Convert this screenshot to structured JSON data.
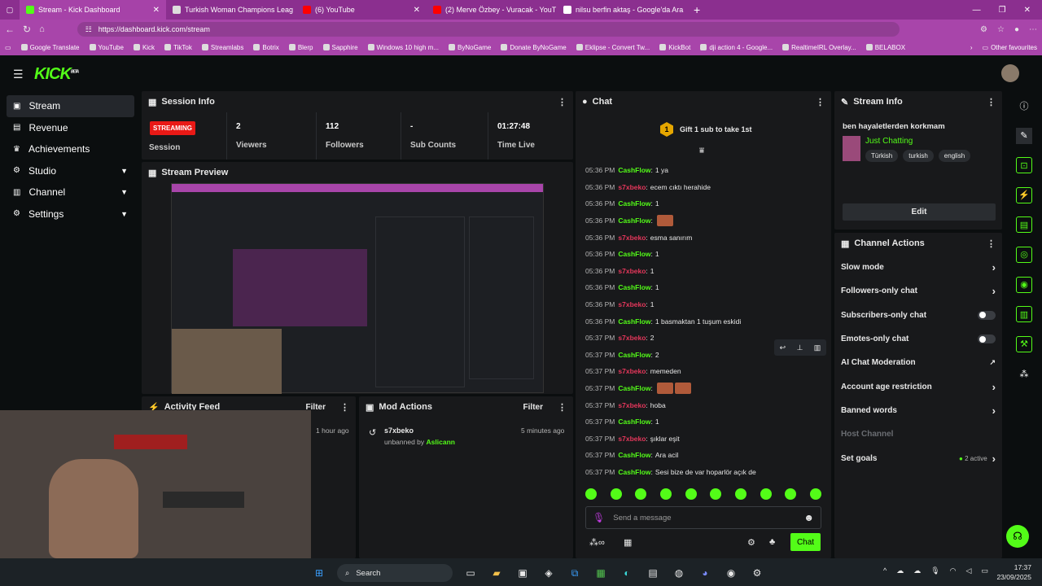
{
  "browser": {
    "tabs": [
      {
        "label": "Stream - Kick Dashboard",
        "color": "#53fc18"
      },
      {
        "label": "Turkish Woman Champions Leag",
        "color": "#dddddd"
      },
      {
        "label": "(6) YouTube",
        "color": "#ff0000"
      },
      {
        "label": "(2) Merve Özbey - Vuracak - YouT",
        "color": "#ff0000"
      },
      {
        "label": "nilsu berfin aktaş - Google'da Ara",
        "color": "#ffffff"
      }
    ],
    "url": "https://dashboard.kick.com/stream",
    "bookmarks": [
      "Google Translate",
      "YouTube",
      "Kick",
      "TikTok",
      "Streamlabs",
      "Botrix",
      "Blerp",
      "Sapphire",
      "Windows 10 high m...",
      "ByNoGame",
      "Donate ByNoGame",
      "Eklipse - Convert Tw...",
      "KickBot",
      "dji action 4 - Google...",
      "RealtimeIRL Overlay...",
      "BELABOX"
    ],
    "other_favourites": "Other favourites"
  },
  "app": {
    "logo": "KICK",
    "logo_badge": "BETA",
    "nav": [
      {
        "label": "Stream",
        "icon": "video-icon",
        "chevron": false
      },
      {
        "label": "Revenue",
        "icon": "dollar-icon",
        "chevron": false
      },
      {
        "label": "Achievements",
        "icon": "trophy-icon",
        "chevron": false
      },
      {
        "label": "Studio",
        "icon": "studio-icon",
        "chevron": true
      },
      {
        "label": "Channel",
        "icon": "channel-icon",
        "chevron": true
      },
      {
        "label": "Settings",
        "icon": "gear-icon",
        "chevron": true
      }
    ]
  },
  "session": {
    "title": "Session Info",
    "status": "STREAMING",
    "session_label": "Session",
    "stats": [
      {
        "value": "2",
        "label": "Viewers"
      },
      {
        "value": "112",
        "label": "Followers"
      },
      {
        "value": "-",
        "label": "Sub Counts"
      },
      {
        "value": "01:27:48",
        "label": "Time Live"
      }
    ]
  },
  "preview": {
    "title": "Stream Preview"
  },
  "activity": {
    "title": "Activity Feed",
    "filter": "Filter",
    "time": "1 hour ago"
  },
  "mod": {
    "title": "Mod Actions",
    "filter": "Filter",
    "user": "s7xbeko",
    "action": "unbanned by",
    "by": "Aslicann",
    "time": "5 minutes ago"
  },
  "chat": {
    "title": "Chat",
    "gift_text": "Gift 1 sub to take 1st",
    "gift_rank": "1",
    "messages": [
      {
        "time": "05:36 PM",
        "user": "CashFlow",
        "c": 1,
        "text": "1 ya",
        "emotes": 0
      },
      {
        "time": "05:36 PM",
        "user": "s7xbeko",
        "c": 2,
        "text": "ecem cıktı herahide",
        "emotes": 0
      },
      {
        "time": "05:36 PM",
        "user": "CashFlow",
        "c": 1,
        "text": "1",
        "emotes": 0
      },
      {
        "time": "05:36 PM",
        "user": "CashFlow",
        "c": 1,
        "text": "",
        "emotes": 1
      },
      {
        "time": "05:36 PM",
        "user": "s7xbeko",
        "c": 2,
        "text": "esma sanırım",
        "emotes": 0
      },
      {
        "time": "05:36 PM",
        "user": "CashFlow",
        "c": 1,
        "text": "1",
        "emotes": 0
      },
      {
        "time": "05:36 PM",
        "user": "s7xbeko",
        "c": 2,
        "text": "1",
        "emotes": 0
      },
      {
        "time": "05:36 PM",
        "user": "CashFlow",
        "c": 1,
        "text": "1",
        "emotes": 0
      },
      {
        "time": "05:36 PM",
        "user": "s7xbeko",
        "c": 2,
        "text": "1",
        "emotes": 0
      },
      {
        "time": "05:36 PM",
        "user": "CashFlow",
        "c": 1,
        "text": "1 basmaktan 1 tuşum eskidi",
        "emotes": 0
      },
      {
        "time": "05:37 PM",
        "user": "s7xbeko",
        "c": 2,
        "text": "2",
        "emotes": 0
      },
      {
        "time": "05:37 PM",
        "user": "CashFlow",
        "c": 1,
        "text": "2",
        "emotes": 0
      },
      {
        "time": "05:37 PM",
        "user": "s7xbeko",
        "c": 2,
        "text": "memeden",
        "emotes": 0
      },
      {
        "time": "05:37 PM",
        "user": "CashFlow",
        "c": 1,
        "text": "",
        "emotes": 2
      },
      {
        "time": "05:37 PM",
        "user": "s7xbeko",
        "c": 2,
        "text": "hoba",
        "emotes": 0
      },
      {
        "time": "05:37 PM",
        "user": "CashFlow",
        "c": 1,
        "text": "1",
        "emotes": 0
      },
      {
        "time": "05:37 PM",
        "user": "s7xbeko",
        "c": 2,
        "text": "şıklar eşit",
        "emotes": 0
      },
      {
        "time": "05:37 PM",
        "user": "CashFlow",
        "c": 1,
        "text": "Ara acil",
        "emotes": 0
      },
      {
        "time": "05:37 PM",
        "user": "CashFlow",
        "c": 1,
        "text": "Sesi bize de var hoparlör açık de",
        "emotes": 0
      }
    ],
    "placeholder": "Send a message",
    "send": "Chat"
  },
  "stream_info": {
    "title": "Stream Info",
    "stream_title": "ben hayaletlerden korkmam",
    "category": "Just Chatting",
    "tags": [
      "Türkish",
      "turkish",
      "english"
    ],
    "edit": "Edit"
  },
  "channel_actions": {
    "title": "Channel Actions",
    "items": [
      {
        "label": "Slow mode",
        "kind": "chevron"
      },
      {
        "label": "Followers-only chat",
        "kind": "chevron"
      },
      {
        "label": "Subscribers-only chat",
        "kind": "toggle"
      },
      {
        "label": "Emotes-only chat",
        "kind": "toggle"
      },
      {
        "label": "AI Chat Moderation",
        "kind": "link"
      },
      {
        "label": "Account age restriction",
        "kind": "chevron"
      },
      {
        "label": "Banned words",
        "kind": "chevron"
      },
      {
        "label": "Host Channel",
        "kind": "disabled"
      },
      {
        "label": "Set goals",
        "kind": "chevron"
      }
    ],
    "goals_status": "2 active"
  },
  "taskbar": {
    "search": "Search",
    "time": "17:37",
    "date": "23/09/2025"
  },
  "colors": {
    "accent": "#53fc18",
    "streaming": "#e91916",
    "user_red": "#e5375b"
  }
}
